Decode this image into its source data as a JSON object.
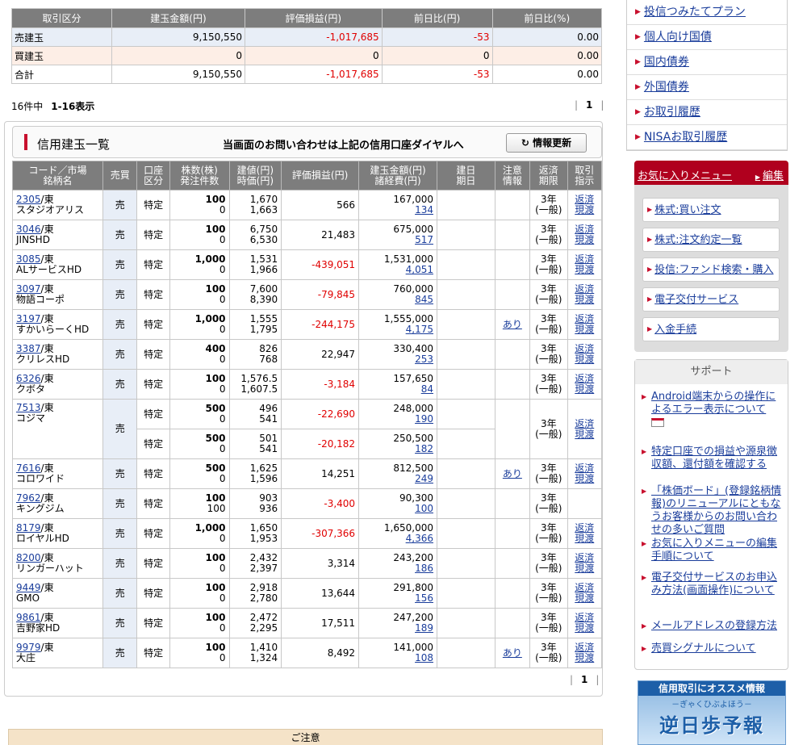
{
  "summary": {
    "headers": [
      "取引区分",
      "建玉金額(円)",
      "評価損益(円)",
      "前日比(円)",
      "前日比(%)"
    ],
    "rows": [
      {
        "label": "売建玉",
        "amount": "9,150,550",
        "pl": "-1,017,685",
        "chg": "-53",
        "pct": "0.00"
      },
      {
        "label": "買建玉",
        "amount": "0",
        "pl": "0",
        "chg": "0",
        "pct": "0.00"
      },
      {
        "label": "合計",
        "amount": "9,150,550",
        "pl": "-1,017,685",
        "chg": "-53",
        "pct": "0.00"
      }
    ]
  },
  "count": {
    "total": "16件中",
    "range": "1-16表示"
  },
  "pager": {
    "page": "1"
  },
  "list": {
    "title": "信用建玉一覧",
    "notice": "当画面のお問い合わせは上記の信用口座ダイヤルへ",
    "refresh": "情報更新",
    "headers": [
      "コード／市場\n銘柄名",
      "売買",
      "口座\n区分",
      "株数(株)\n発注件数",
      "建値(円)\n時価(円)",
      "評価損益(円)",
      "建玉金額(円)\n諸経費(円)",
      "建日\n期日",
      "注意\n情報",
      "返済\n期限",
      "取引\n指示"
    ],
    "rows": [
      {
        "code": "2305",
        "mkt": "/東",
        "name": "スタジオアリス",
        "side": "売",
        "acct": "特定",
        "qty": "100",
        "orders": "0",
        "open": "1,670",
        "cur": "1,663",
        "pl": "566",
        "amt": "167,000",
        "fee": "134",
        "note": "",
        "term": "3年",
        "term2": "(一般)",
        "a1": "返済",
        "a2": "現渡"
      },
      {
        "code": "3046",
        "mkt": "/東",
        "name": "JINSHD",
        "side": "売",
        "acct": "特定",
        "qty": "100",
        "orders": "0",
        "open": "6,750",
        "cur": "6,530",
        "pl": "21,483",
        "amt": "675,000",
        "fee": "517",
        "note": "",
        "term": "3年",
        "term2": "(一般)",
        "a1": "返済",
        "a2": "現渡"
      },
      {
        "code": "3085",
        "mkt": "/東",
        "name": "ALサービスHD",
        "side": "売",
        "acct": "特定",
        "qty": "1,000",
        "orders": "0",
        "open": "1,531",
        "cur": "1,966",
        "pl": "-439,051",
        "amt": "1,531,000",
        "fee": "4,051",
        "note": "",
        "term": "3年",
        "term2": "(一般)",
        "a1": "返済",
        "a2": "現渡"
      },
      {
        "code": "3097",
        "mkt": "/東",
        "name": "物語コーポ",
        "side": "売",
        "acct": "特定",
        "qty": "100",
        "orders": "0",
        "open": "7,600",
        "cur": "8,390",
        "pl": "-79,845",
        "amt": "760,000",
        "fee": "845",
        "note": "",
        "term": "3年",
        "term2": "(一般)",
        "a1": "返済",
        "a2": "現渡"
      },
      {
        "code": "3197",
        "mkt": "/東",
        "name": "すかいらーくHD",
        "side": "売",
        "acct": "特定",
        "qty": "1,000",
        "orders": "0",
        "open": "1,555",
        "cur": "1,795",
        "pl": "-244,175",
        "amt": "1,555,000",
        "fee": "4,175",
        "note": "あり",
        "term": "3年",
        "term2": "(一般)",
        "a1": "返済",
        "a2": "現渡"
      },
      {
        "code": "3387",
        "mkt": "/東",
        "name": "クリレスHD",
        "side": "売",
        "acct": "特定",
        "qty": "400",
        "orders": "0",
        "open": "826",
        "cur": "768",
        "pl": "22,947",
        "amt": "330,400",
        "fee": "253",
        "note": "",
        "term": "3年",
        "term2": "(一般)",
        "a1": "返済",
        "a2": "現渡"
      },
      {
        "code": "6326",
        "mkt": "/東",
        "name": "クボタ",
        "side": "売",
        "acct": "特定",
        "qty": "100",
        "orders": "0",
        "open": "1,576.5",
        "cur": "1,607.5",
        "pl": "-3,184",
        "amt": "157,650",
        "fee": "84",
        "note": "",
        "term": "3年",
        "term2": "(一般)",
        "a1": "返済",
        "a2": "現渡"
      },
      {
        "code": "7513",
        "mkt": "/東",
        "name": "コジマ",
        "side": "売",
        "acct": "特定",
        "qty": "500",
        "orders": "0",
        "open": "496",
        "cur": "541",
        "pl": "-22,690",
        "amt": "248,000",
        "fee": "190",
        "note": "",
        "term": "3年",
        "term2": "(一般)",
        "a1": "返済",
        "a2": "現渡",
        "sub": {
          "acct": "特定",
          "qty": "500",
          "orders": "0",
          "open": "501",
          "cur": "541",
          "pl": "-20,182",
          "amt": "250,500",
          "fee": "182"
        }
      },
      {
        "code": "7616",
        "mkt": "/東",
        "name": "コロワイド",
        "side": "売",
        "acct": "特定",
        "qty": "500",
        "orders": "0",
        "open": "1,625",
        "cur": "1,596",
        "pl": "14,251",
        "amt": "812,500",
        "fee": "249",
        "note": "あり",
        "term": "3年",
        "term2": "(一般)",
        "a1": "返済",
        "a2": "現渡"
      },
      {
        "code": "7962",
        "mkt": "/東",
        "name": "キングジム",
        "side": "売",
        "acct": "特定",
        "qty": "100",
        "orders": "100",
        "open": "903",
        "cur": "936",
        "pl": "-3,400",
        "amt": "90,300",
        "fee": "100",
        "note": "",
        "term": "3年",
        "term2": "(一般)",
        "a1": "",
        "a2": ""
      },
      {
        "code": "8179",
        "mkt": "/東",
        "name": "ロイヤルHD",
        "side": "売",
        "acct": "特定",
        "qty": "1,000",
        "orders": "0",
        "open": "1,650",
        "cur": "1,953",
        "pl": "-307,366",
        "amt": "1,650,000",
        "fee": "4,366",
        "note": "",
        "term": "3年",
        "term2": "(一般)",
        "a1": "返済",
        "a2": "現渡"
      },
      {
        "code": "8200",
        "mkt": "/東",
        "name": "リンガーハット",
        "side": "売",
        "acct": "特定",
        "qty": "100",
        "orders": "0",
        "open": "2,432",
        "cur": "2,397",
        "pl": "3,314",
        "amt": "243,200",
        "fee": "186",
        "note": "",
        "term": "3年",
        "term2": "(一般)",
        "a1": "返済",
        "a2": "現渡"
      },
      {
        "code": "9449",
        "mkt": "/東",
        "name": "GMO",
        "side": "売",
        "acct": "特定",
        "qty": "100",
        "orders": "0",
        "open": "2,918",
        "cur": "2,780",
        "pl": "13,644",
        "amt": "291,800",
        "fee": "156",
        "note": "",
        "term": "3年",
        "term2": "(一般)",
        "a1": "返済",
        "a2": "現渡"
      },
      {
        "code": "9861",
        "mkt": "/東",
        "name": "吉野家HD",
        "side": "売",
        "acct": "特定",
        "qty": "100",
        "orders": "0",
        "open": "2,472",
        "cur": "2,295",
        "pl": "17,511",
        "amt": "247,200",
        "fee": "189",
        "note": "",
        "term": "3年",
        "term2": "(一般)",
        "a1": "返済",
        "a2": "現渡"
      },
      {
        "code": "9979",
        "mkt": "/東",
        "name": "大庄",
        "side": "売",
        "acct": "特定",
        "qty": "100",
        "orders": "0",
        "open": "1,410",
        "cur": "1,324",
        "pl": "8,492",
        "amt": "141,000",
        "fee": "108",
        "note": "あり",
        "term": "3年",
        "term2": "(一般)",
        "a1": "返済",
        "a2": "現渡"
      }
    ]
  },
  "caution": "ご注意",
  "right_links": [
    "投信つみたてプラン",
    "個人向け国債",
    "国内債券",
    "外国債券",
    "お取引履歴",
    "NISAお取引履歴"
  ],
  "favorites": {
    "title": "お気に入りメニュー",
    "edit": "編集",
    "items": [
      "株式:買い注文",
      "株式:注文約定一覧",
      "投信:ファンド検索・購入",
      "電子交付サービス",
      "入金手続"
    ]
  },
  "support": {
    "title": "サポート",
    "items": [
      "Android端末からの操作によるエラー表示について",
      "特定口座での損益や源泉徴収額、還付額を確認する",
      "「株価ボード」(登録銘柄情報)のリニューアルにともなうお客様からのお問い合わせの多いご質問",
      "お気に入りメニューの編集手順について",
      "電子交付サービスのお申込み方法(画面操作)について",
      "メールアドレスの登録方法",
      "売買シグナルについて"
    ]
  },
  "banner": {
    "top": "信用取引にオススメ情報",
    "sub": "－ぎゃくひぶよほう－",
    "main": "逆日歩予報"
  }
}
